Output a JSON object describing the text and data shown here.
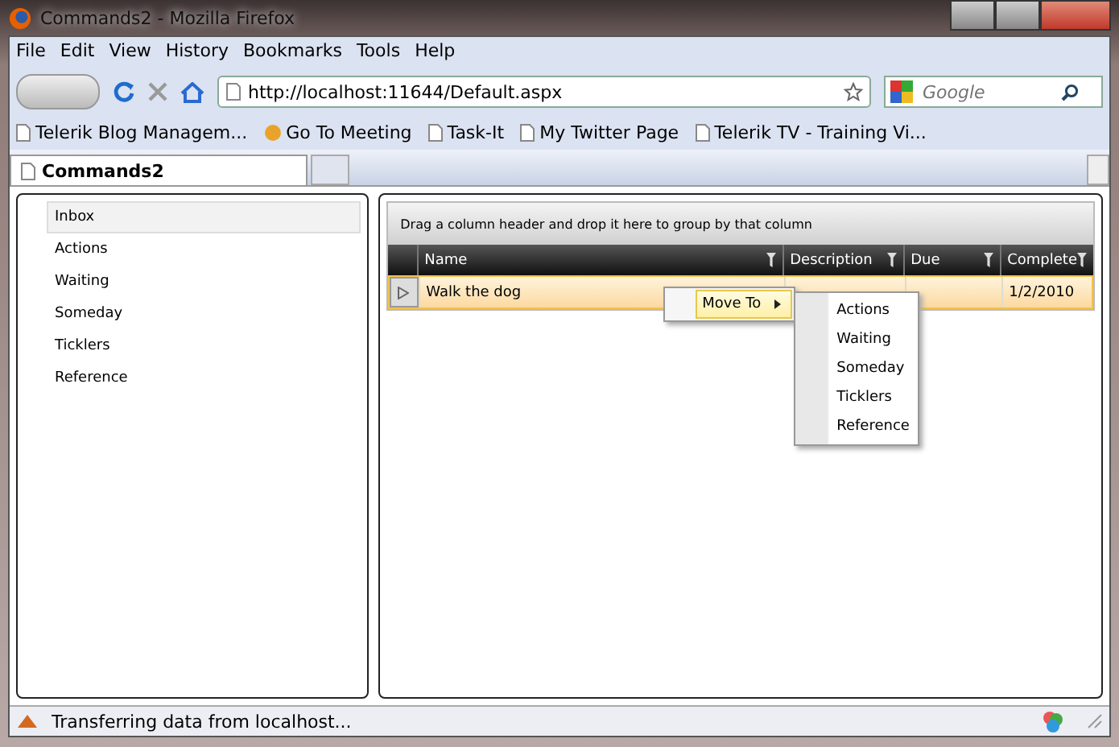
{
  "window": {
    "title": "Commands2 - Mozilla Firefox"
  },
  "menu_bar": [
    "File",
    "Edit",
    "View",
    "History",
    "Bookmarks",
    "Tools",
    "Help"
  ],
  "nav": {
    "url": "http://localhost:11644/Default.aspx",
    "search_placeholder": "Google"
  },
  "bookmarks": [
    "Telerik Blog Managem...",
    "Go To Meeting",
    "Task-It",
    "My Twitter Page",
    "Telerik TV - Training Vi..."
  ],
  "tabs": [
    {
      "label": "Commands2",
      "selected": true
    }
  ],
  "sidebar": {
    "items": [
      {
        "label": "Inbox",
        "selected": true
      },
      {
        "label": "Actions",
        "selected": false
      },
      {
        "label": "Waiting",
        "selected": false
      },
      {
        "label": "Someday",
        "selected": false
      },
      {
        "label": "Ticklers",
        "selected": false
      },
      {
        "label": "Reference",
        "selected": false
      }
    ]
  },
  "grid": {
    "group_hint": "Drag a column header and drop it here to group by that column",
    "columns": [
      "Name",
      "Description",
      "Due",
      "Complete"
    ],
    "rows": [
      {
        "cells": [
          "Walk the dog",
          "",
          "",
          "1/2/2010"
        ],
        "selected": true
      }
    ]
  },
  "context_menu": {
    "items": [
      {
        "label": "Move To",
        "highlighted": true
      }
    ]
  },
  "submenu": {
    "items": [
      "Actions",
      "Waiting",
      "Someday",
      "Ticklers",
      "Reference"
    ]
  },
  "status_bar": {
    "text": "Transferring data from localhost..."
  }
}
